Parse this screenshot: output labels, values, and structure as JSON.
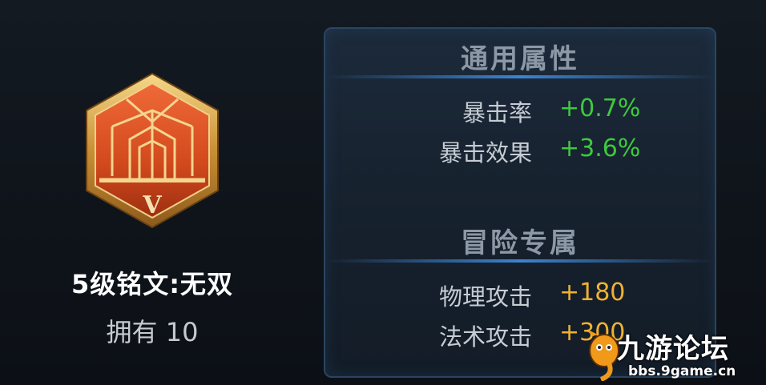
{
  "rune": {
    "badge_tier": "V",
    "name": "5级铭文:无双",
    "owned": "拥有 10",
    "badge_icon": "hexagon-rune-badge-icon"
  },
  "panel": {
    "general": {
      "title": "通用属性",
      "stats": [
        {
          "label": "暴击率",
          "value": "+0.7%"
        },
        {
          "label": "暴击效果",
          "value": "+3.6%"
        }
      ]
    },
    "adventure": {
      "title": "冒险专属",
      "stats": [
        {
          "label": "物理攻击",
          "value": "+180"
        },
        {
          "label": "法术攻击",
          "value": "+300"
        }
      ]
    }
  },
  "watermark": {
    "site_name": "九游论坛",
    "url": "bbs.9game.cn",
    "logo_icon": "9game-mascot-icon"
  },
  "colors": {
    "general_value": "#3ec93e",
    "adventure_value": "#f0b230",
    "title_glow": "#3b83d1",
    "badge_gold": "#d9a64a",
    "badge_red": "#d2491d"
  }
}
